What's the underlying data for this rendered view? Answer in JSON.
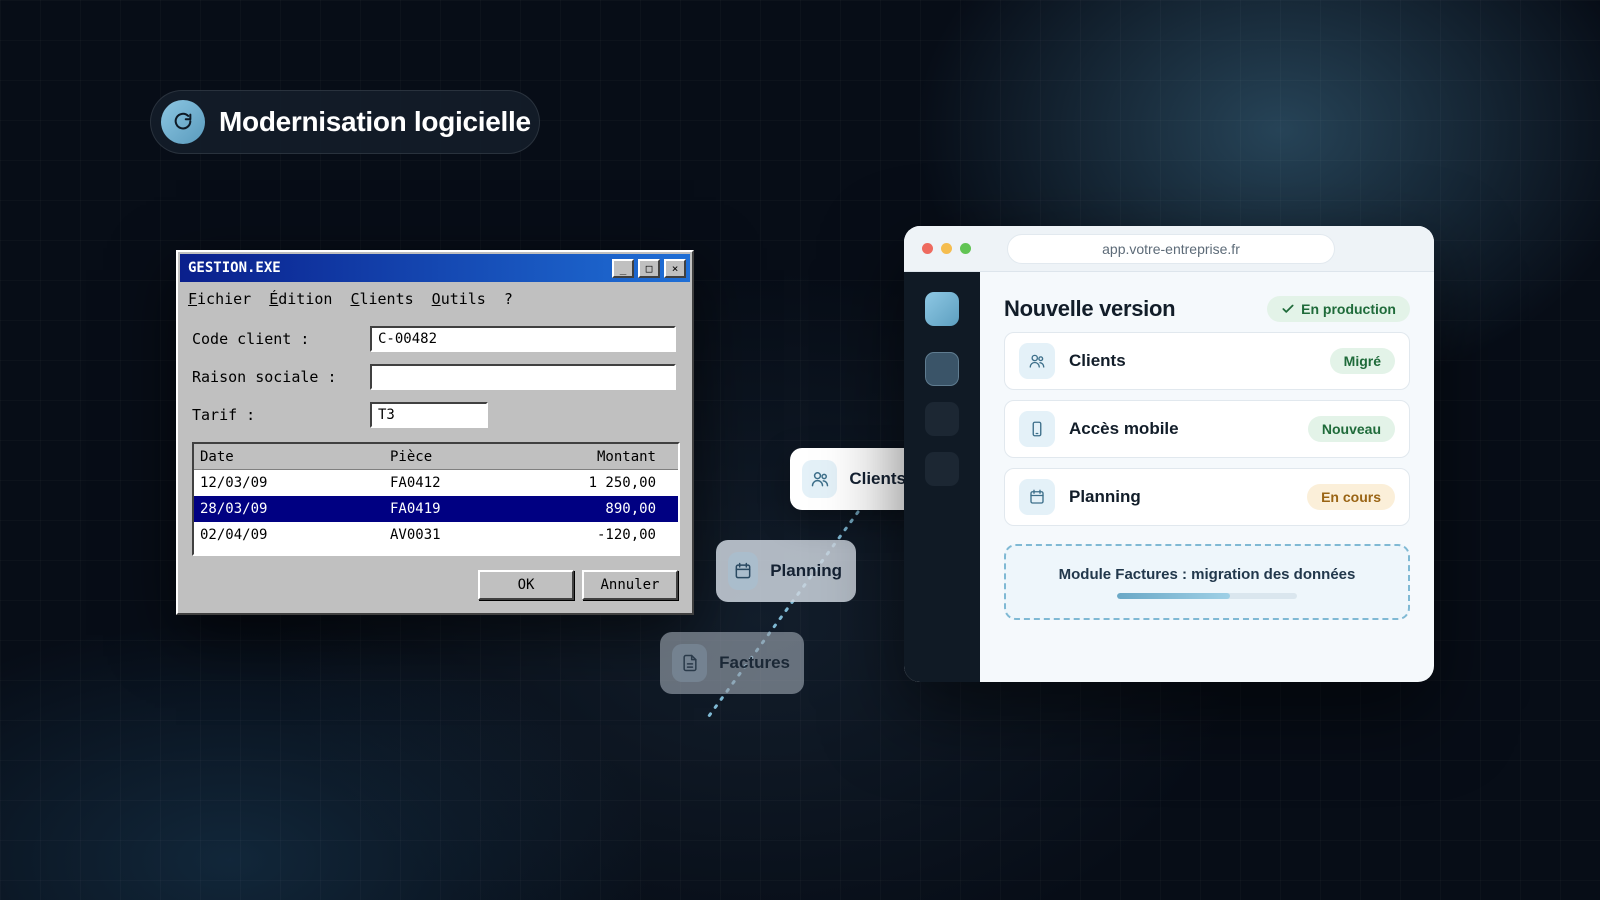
{
  "header": {
    "title": "Modernisation logicielle",
    "icon": "refresh-icon"
  },
  "legacy": {
    "window_title": "GESTION.EXE",
    "window_buttons": [
      "_",
      "□",
      "×"
    ],
    "menu": [
      "Fichier",
      "Édition",
      "Clients",
      "Outils",
      "?"
    ],
    "fields": {
      "code_client_label": "Code client :",
      "code_client_value": "C-00482",
      "raison_sociale_label": "Raison sociale :",
      "raison_sociale_value": "",
      "tarif_label": "Tarif :",
      "tarif_value": "T3"
    },
    "table": {
      "headers": [
        "Date",
        "Pièce",
        "Montant"
      ],
      "rows": [
        [
          "12/03/09",
          "FA0412",
          "1 250,00"
        ],
        [
          "28/03/09",
          "FA0419",
          "890,00"
        ],
        [
          "02/04/09",
          "AV0031",
          "-120,00"
        ]
      ],
      "selected_row": 1
    },
    "buttons": {
      "ok": "OK",
      "cancel": "Annuler"
    }
  },
  "chips": {
    "clients": {
      "label": "Clients",
      "icon": "users-icon"
    },
    "planning": {
      "label": "Planning",
      "icon": "calendar-icon"
    },
    "factures": {
      "label": "Factures",
      "icon": "document-icon"
    }
  },
  "browser": {
    "url": "app.votre-entreprise.fr",
    "title": "Nouvelle version",
    "status_badge": "En production",
    "modules": [
      {
        "label": "Clients",
        "badge": "Migré",
        "icon": "users-icon"
      },
      {
        "label": "Accès mobile",
        "badge": "Nouveau",
        "icon": "smartphone-icon"
      },
      {
        "label": "Planning",
        "badge": "En cours",
        "icon": "calendar-icon"
      }
    ],
    "migration": {
      "label": "Module Factures : migration des données",
      "progress": 0.63
    }
  },
  "colors": {
    "background": "#070d17",
    "accent": "#6aa8c6",
    "legacy_titlebar": "#0a1f8c",
    "legacy_selection": "#000082",
    "success": "#1f6b3a",
    "warning": "#9a6414",
    "traffic_red": "#ee6a5f",
    "traffic_yellow": "#f5bd4f",
    "traffic_green": "#61c454"
  }
}
